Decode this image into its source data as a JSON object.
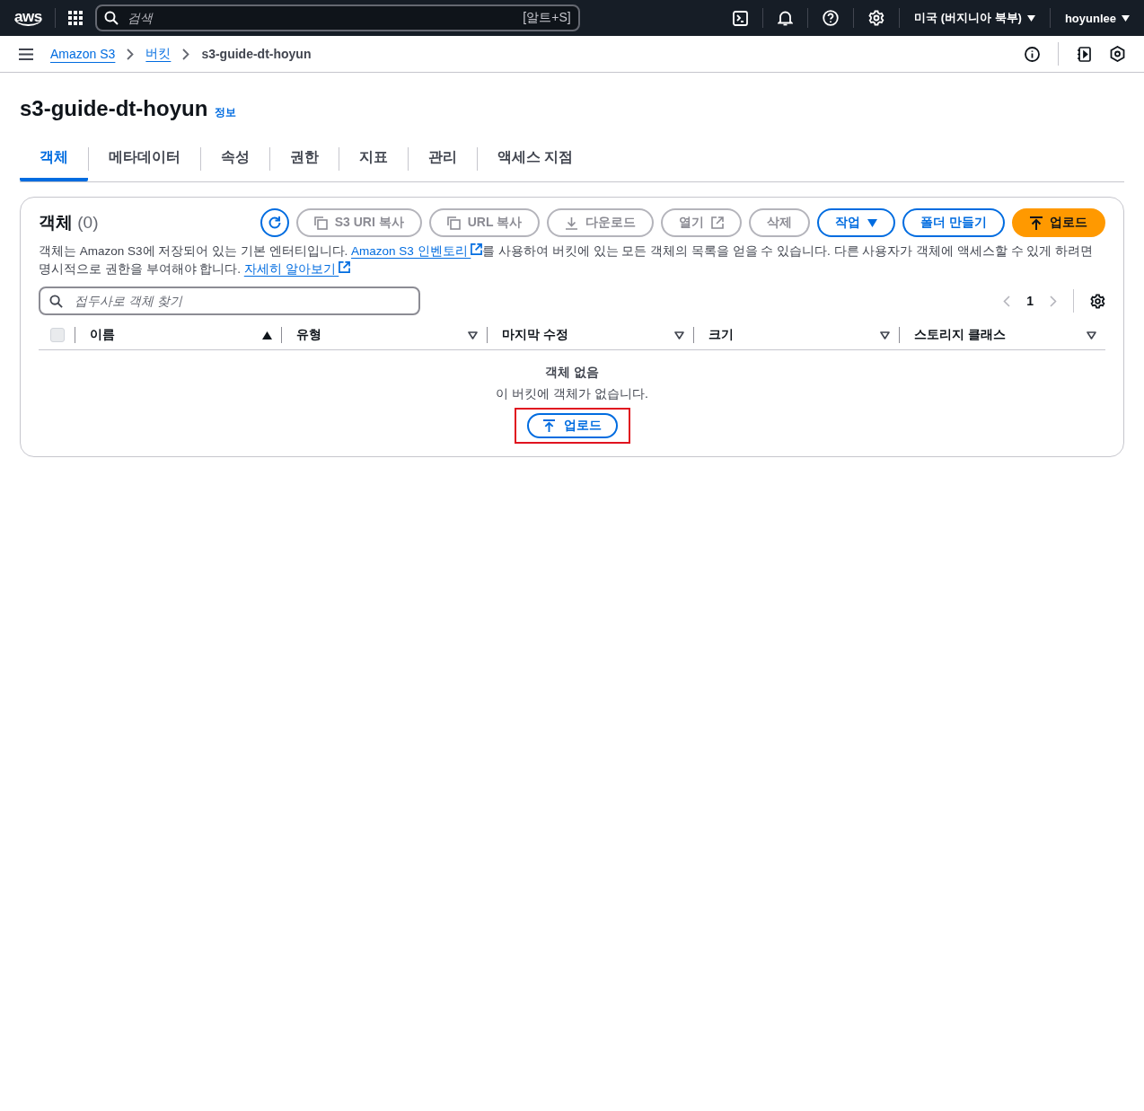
{
  "top_nav": {
    "logo": "aws",
    "search": {
      "placeholder": "검색",
      "shortcut": "[알트+S]"
    },
    "region": "미국 (버지니아 북부)",
    "user": "hoyunlee"
  },
  "breadcrumbs": [
    {
      "label": "Amazon S3",
      "kind": "link"
    },
    {
      "label": "버킷",
      "kind": "link"
    },
    {
      "label": "s3-guide-dt-hoyun",
      "kind": "current"
    }
  ],
  "page_title": "s3-guide-dt-hoyun",
  "info_link": "정보",
  "tabs": [
    {
      "label": "객체",
      "selected": true
    },
    {
      "label": "메타데이터",
      "selected": false
    },
    {
      "label": "속성",
      "selected": false
    },
    {
      "label": "권한",
      "selected": false
    },
    {
      "label": "지표",
      "selected": false
    },
    {
      "label": "관리",
      "selected": false
    },
    {
      "label": "액세스 지점",
      "selected": false
    }
  ],
  "objects_panel": {
    "title": "객체",
    "count": "(0)",
    "actions": [
      {
        "kind": "refresh",
        "disabled": false
      },
      {
        "kind": "copy",
        "label": "S3 URI 복사",
        "disabled": true
      },
      {
        "kind": "copy",
        "label": "URL 복사",
        "disabled": true
      },
      {
        "kind": "download",
        "label": "다운로드",
        "disabled": true
      },
      {
        "kind": "external",
        "label": "열기",
        "disabled": true
      },
      {
        "kind": "plain",
        "label": "삭제",
        "disabled": true
      },
      {
        "kind": "dropdown",
        "label": "작업",
        "disabled": false
      },
      {
        "kind": "plain",
        "label": "폴더 만들기",
        "disabled": false
      },
      {
        "kind": "upload",
        "label": "업로드",
        "disabled": false
      }
    ],
    "description": [
      {
        "kind": "text",
        "text": "객체는 Amazon S3에 저장되어 있는 기본 엔터티입니다. "
      },
      {
        "kind": "link",
        "text": "Amazon S3 인벤토리"
      },
      {
        "kind": "text",
        "text": "를 사용하여 버킷에 있는 모든 객체의 목록을 얻을 수 있습니다. 다른 사용자가 객체에 액세스할 수 있게 하려면 명시적으로 권한을 부여해야 합니다. "
      },
      {
        "kind": "link",
        "text": "자세히 알아보기"
      }
    ],
    "filter": {
      "placeholder": "접두사로 객체 찾기"
    },
    "page": "1",
    "select_all": {
      "checked": false
    },
    "columns": [
      {
        "label": "이름",
        "sorted": true
      },
      {
        "label": "유형",
        "sorted": false
      },
      {
        "label": "마지막 수정",
        "sorted": false
      },
      {
        "label": "크기",
        "sorted": false
      },
      {
        "label": "스토리지 클래스",
        "sorted": false
      }
    ],
    "empty": {
      "title": "객체 없음",
      "message": "이 버킷에 객체가 없습니다.",
      "button": "업로드",
      "highlighted": true
    }
  }
}
